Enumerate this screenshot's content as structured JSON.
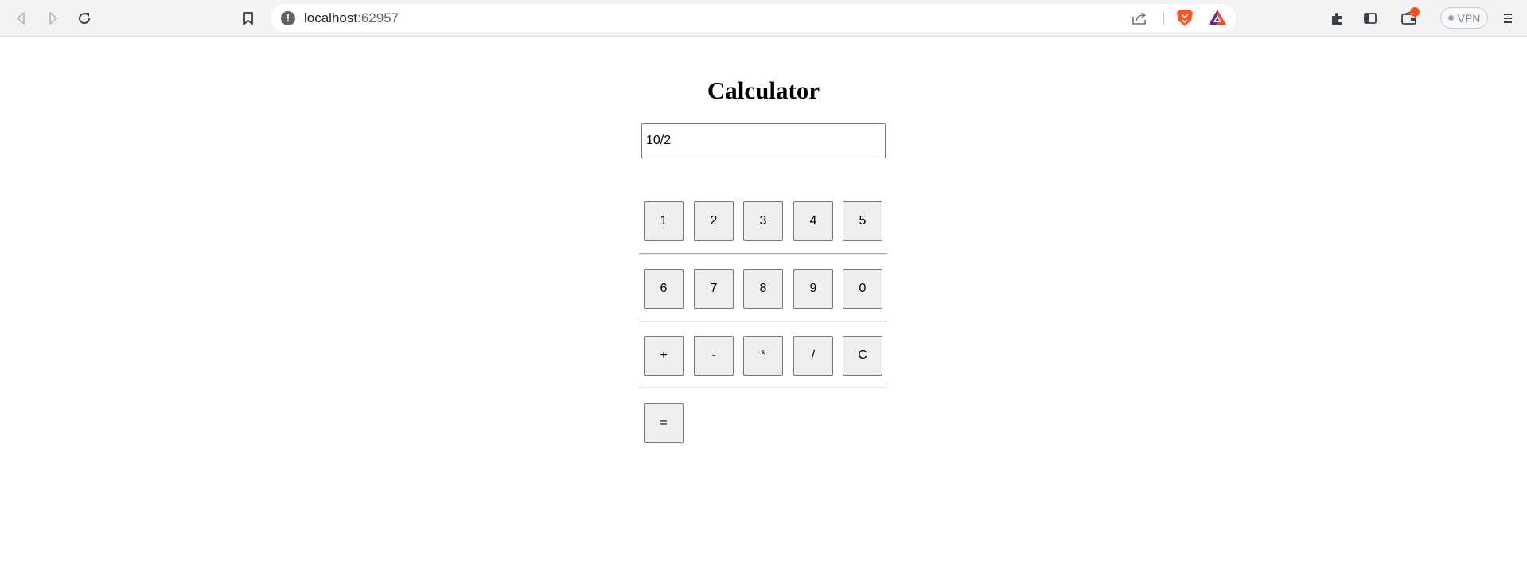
{
  "browser": {
    "url_host": "localhost",
    "url_port": ":62957",
    "vpn_label": "VPN",
    "icons": {
      "back": "back-arrow-icon",
      "forward": "forward-arrow-icon",
      "reload": "reload-icon",
      "bookmark": "bookmark-icon",
      "site_info": "site-info-icon",
      "share": "share-icon",
      "brave_shields": "brave-shields-icon",
      "brave_rewards": "brave-rewards-icon",
      "extensions": "extensions-icon",
      "sidebar": "sidebar-icon",
      "wallet": "wallet-icon",
      "menu": "menu-icon"
    },
    "colors": {
      "brave_orange": "#fb542b",
      "wallet_badge": "#f4511e"
    }
  },
  "page": {
    "title": "Calculator",
    "display_value": "10/2",
    "rows": [
      [
        "1",
        "2",
        "3",
        "4",
        "5"
      ],
      [
        "6",
        "7",
        "8",
        "9",
        "0"
      ],
      [
        "+",
        "-",
        "*",
        "/",
        "C"
      ],
      [
        "="
      ]
    ]
  }
}
